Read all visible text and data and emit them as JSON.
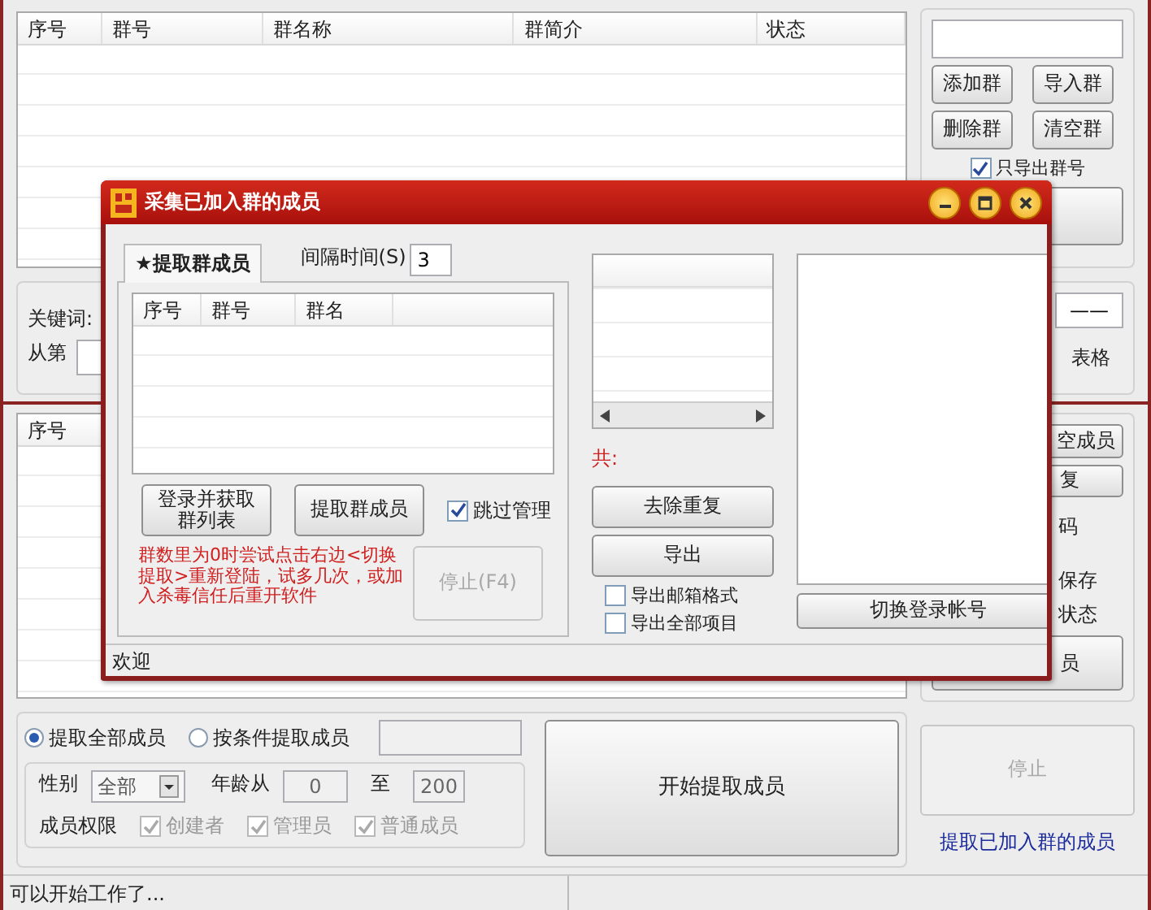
{
  "main_window": {
    "group_table": {
      "columns": [
        "序号",
        "群号",
        "群名称",
        "群简介",
        "状态"
      ]
    },
    "keyword_label": "关键词:",
    "from_label": "从第",
    "member_table": {
      "columns": [
        "序号"
      ]
    },
    "extract_mode": [
      {
        "label": "提取全部成员",
        "selected": true
      },
      {
        "label": "按条件提取成员",
        "selected": false
      }
    ],
    "gender": {
      "label": "性别",
      "value": "全部"
    },
    "age": {
      "label": "年龄从",
      "from": "0",
      "to_label": "至",
      "to": "200"
    },
    "roles": {
      "label": "成员权限",
      "disabled": true,
      "options": [
        {
          "label": "创建者",
          "checked": true
        },
        {
          "label": "管理员",
          "checked": true
        },
        {
          "label": "普通成员",
          "checked": true
        }
      ]
    },
    "start_button": "开始提取成员",
    "group_buttons": [
      "添加群",
      "导入群",
      "删除群",
      "清空群"
    ],
    "export_ids_only": {
      "label": "只导出群号",
      "checked": true
    },
    "middle_field": "——",
    "table_label": "表格",
    "member_buttons": [
      "空成员",
      "复"
    ],
    "option_texts": [
      "码",
      "保存",
      "状态"
    ],
    "member_action_button": "员",
    "stop_button": {
      "label": "停止",
      "disabled": true
    },
    "extract_link": "提取已加入群的成员"
  },
  "status_bar": {
    "message": "可以开始工作了..."
  },
  "dialog": {
    "title": "采集已加入群的成员",
    "tab": {
      "label": "★提取群成员",
      "selected": true
    },
    "interval": {
      "label": "间隔时间(S)",
      "value": "3"
    },
    "group_list": {
      "columns": [
        "序号",
        "群号",
        "群名"
      ]
    },
    "login_button": "登录并获取群列表",
    "extract_button": "提取群成员",
    "skip_admins": {
      "label": "跳过管理",
      "checked": true
    },
    "hint": "群数里为0时尝试点击右边<切换提取>重新登陆，试多几次，或加入杀毒信任后重开软件",
    "stop_button": {
      "label": "停止(F4)",
      "disabled": true
    },
    "total_label": "共:",
    "dedupe_button": "去除重复",
    "export_button": "导出",
    "export_options": [
      {
        "label": "导出邮箱格式",
        "checked": false
      },
      {
        "label": "导出全部项目",
        "checked": false
      }
    ],
    "switch_account_button": "切换登录帐号",
    "status": "欢迎"
  }
}
